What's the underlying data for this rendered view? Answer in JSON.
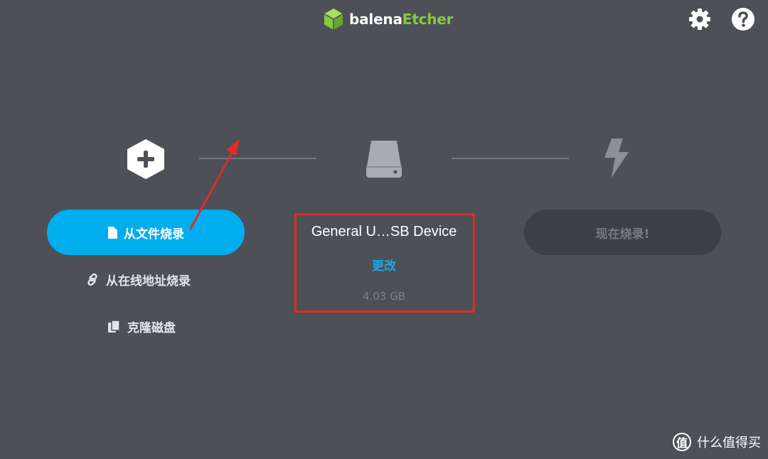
{
  "header": {
    "brand_prefix": "balena",
    "brand_suffix": "Etcher",
    "settings_icon": "gear-icon",
    "help_icon": "question-icon"
  },
  "steps": {
    "image_icon": "plus-hexagon-icon",
    "drive_icon": "drive-icon",
    "flash_icon": "lightning-icon"
  },
  "source": {
    "flash_from_file_label": "从文件烧录",
    "flash_from_url_label": "从在线地址烧录",
    "clone_drive_label": "克隆磁盘"
  },
  "target": {
    "device_name": "General U…SB Device",
    "change_label": "更改",
    "device_size": "4.03 GB"
  },
  "flash": {
    "flash_now_label": "现在烧录!"
  },
  "watermark": {
    "badge": "值",
    "text": "什么值得买"
  },
  "colors": {
    "background": "#4d5057",
    "accent_blue": "#00aeef",
    "brand_green": "#85c940",
    "annotation_red": "#e02b2b",
    "disabled_button": "#3d3f44"
  }
}
